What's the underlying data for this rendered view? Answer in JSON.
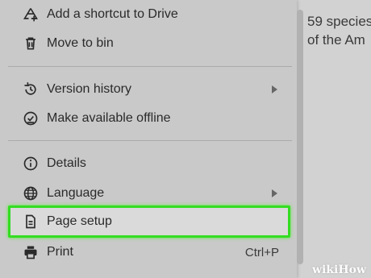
{
  "document": {
    "line1": "59 species",
    "line2": "of the Am"
  },
  "menu": {
    "items": [
      {
        "label": "Add a shortcut to Drive",
        "icon": "add-to-drive-icon"
      },
      {
        "label": "Move to bin",
        "icon": "trash-icon"
      },
      {
        "label": "Version history",
        "icon": "history-icon",
        "submenu": true
      },
      {
        "label": "Make available offline",
        "icon": "offline-check-icon"
      },
      {
        "label": "Details",
        "icon": "info-icon"
      },
      {
        "label": "Language",
        "icon": "globe-icon",
        "submenu": true
      },
      {
        "label": "Page setup",
        "icon": "document-icon",
        "highlighted": true
      },
      {
        "label": "Print",
        "icon": "printer-icon",
        "shortcut": "Ctrl+P"
      }
    ]
  },
  "highlight_color": "#33dd22",
  "watermark": {
    "text1": "wiki",
    "text2": "How"
  }
}
